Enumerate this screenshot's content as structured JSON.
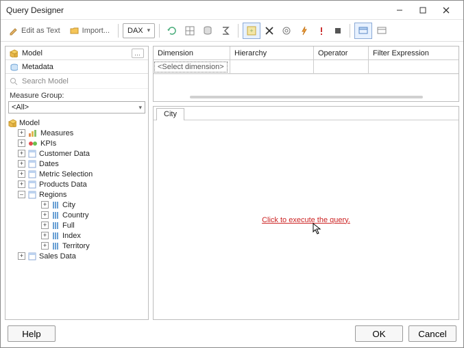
{
  "window": {
    "title": "Query Designer"
  },
  "toolbar": {
    "edit_as_text": "Edit as Text",
    "import": "Import...",
    "language": "DAX"
  },
  "left_panel": {
    "tabs": {
      "model": "Model",
      "metadata": "Metadata"
    },
    "search_placeholder": "Search Model",
    "measure_group_label": "Measure Group:",
    "measure_group_value": "<All>",
    "tree": {
      "root": "Model",
      "children": [
        "Measures",
        "KPIs",
        "Customer Data",
        "Dates",
        "Metric Selection",
        "Products Data",
        "Regions",
        "Sales Data"
      ],
      "regions_children": [
        "City",
        "Country",
        "Full",
        "Index",
        "Territory"
      ]
    }
  },
  "filter_grid": {
    "headers": {
      "dimension": "Dimension",
      "hierarchy": "Hierarchy",
      "operator": "Operator",
      "expression": "Filter Expression"
    },
    "placeholder": "<Select dimension>"
  },
  "results": {
    "tab": "City",
    "execute_link": "Click to execute the query."
  },
  "footer": {
    "help": "Help",
    "ok": "OK",
    "cancel": "Cancel"
  }
}
